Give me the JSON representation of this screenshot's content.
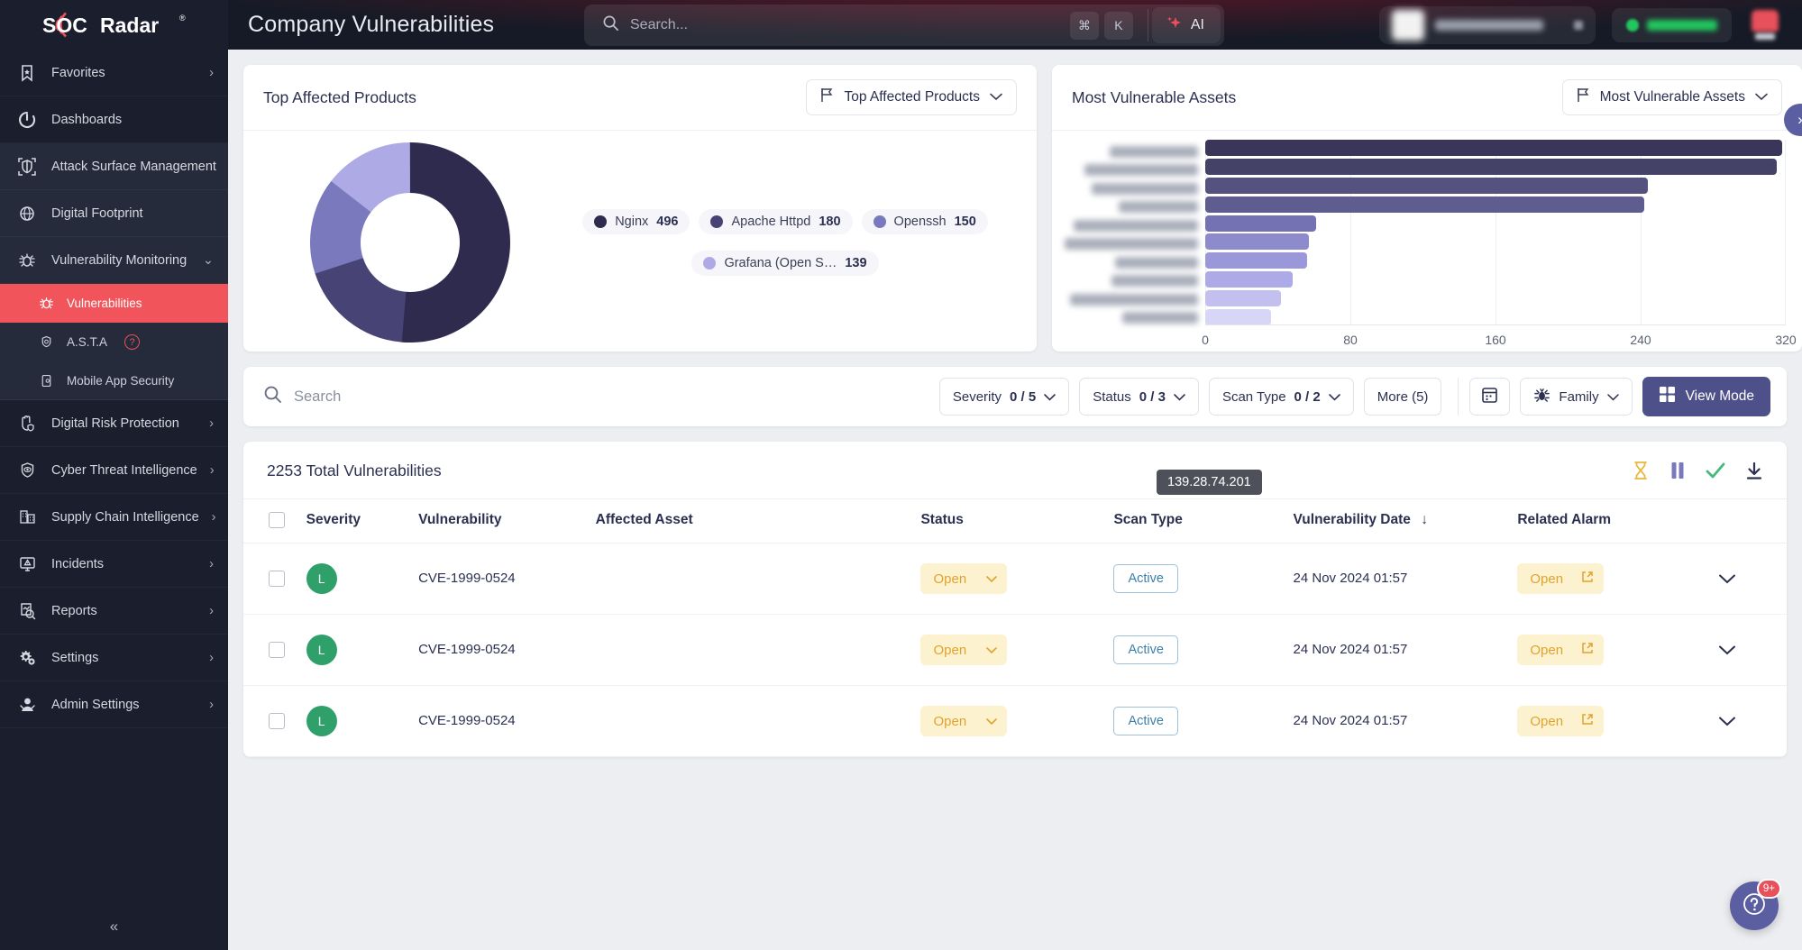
{
  "brand": {
    "name": "SOCRadar",
    "registered": "®"
  },
  "header": {
    "title": "Company Vulnerabilities",
    "search_placeholder": "Search...",
    "kbd_cmd": "⌘",
    "kbd_k": "K",
    "ai_label": "AI"
  },
  "sidebar": {
    "items": [
      {
        "label": "Favorites",
        "icon": "bookmark-star-icon",
        "chevron": "›"
      },
      {
        "label": "Dashboards",
        "icon": "dashboard-icon",
        "chevron": ""
      },
      {
        "label": "Attack Surface Management",
        "icon": "shield-scan-icon",
        "chevron": "⌄"
      },
      {
        "label": "Digital Footprint",
        "icon": "globe-icon",
        "chevron": ""
      },
      {
        "label": "Vulnerability Monitoring",
        "icon": "bug-icon",
        "chevron": "⌄"
      },
      {
        "label": "Digital Risk Protection",
        "icon": "hand-shield-icon",
        "chevron": "›"
      },
      {
        "label": "Cyber Threat Intelligence",
        "icon": "shield-eye-icon",
        "chevron": "›"
      },
      {
        "label": "Supply Chain Intelligence",
        "icon": "factory-icon",
        "chevron": "›"
      },
      {
        "label": "Incidents",
        "icon": "monitor-alert-icon",
        "chevron": "›"
      },
      {
        "label": "Reports",
        "icon": "report-search-icon",
        "chevron": "›"
      },
      {
        "label": "Settings",
        "icon": "gears-icon",
        "chevron": "›"
      },
      {
        "label": "Admin Settings",
        "icon": "admin-icon",
        "chevron": "›"
      }
    ],
    "sub_items": [
      {
        "label": "Vulnerabilities",
        "icon": "bug-icon",
        "active": true,
        "badge": ""
      },
      {
        "label": "A.S.T.A",
        "icon": "shield-badge-icon",
        "active": false,
        "badge": "?"
      },
      {
        "label": "Mobile App Security",
        "icon": "mobile-icon",
        "active": false,
        "badge": ""
      }
    ],
    "collapse": "«"
  },
  "cards": {
    "top_affected": {
      "title": "Top Affected Products",
      "selector": "Top Affected Products"
    },
    "most_vulnerable": {
      "title": "Most Vulnerable Assets",
      "selector": "Most Vulnerable Assets"
    }
  },
  "tooltip": "139.28.74.201",
  "filters": {
    "search_placeholder": "Search",
    "severity": {
      "label": "Severity",
      "value": "0 / 5"
    },
    "status": {
      "label": "Status",
      "value": "0 / 3"
    },
    "scan_type": {
      "label": "Scan Type",
      "value": "0 / 2"
    },
    "more": "More (5)",
    "calendar_icon": "calendar-icon",
    "family": "Family",
    "view_mode": "View Mode"
  },
  "table": {
    "total_text": "2253 Total Vulnerabilities",
    "tool_icons": [
      "hourglass-icon",
      "pause-icon",
      "check-icon",
      "download-icon"
    ],
    "columns": [
      "Severity",
      "Vulnerability",
      "Affected Asset",
      "Status",
      "Scan Type",
      "Vulnerability Date",
      "Related Alarm"
    ],
    "sort_arrow": "↓",
    "rows": [
      {
        "severity": "L",
        "vulnerability": "CVE-1999-0524",
        "asset": "",
        "status": "Open",
        "scan_type": "Active",
        "date": "24 Nov 2024 01:57",
        "alarm": "Open"
      },
      {
        "severity": "L",
        "vulnerability": "CVE-1999-0524",
        "asset": "",
        "status": "Open",
        "scan_type": "Active",
        "date": "24 Nov 2024 01:57",
        "alarm": "Open"
      },
      {
        "severity": "L",
        "vulnerability": "CVE-1999-0524",
        "asset": "",
        "status": "Open",
        "scan_type": "Active",
        "date": "24 Nov 2024 01:57",
        "alarm": "Open"
      }
    ]
  },
  "help": {
    "icon": "question-chat-icon",
    "badge": "9+"
  },
  "colors": {
    "accent_red": "#f2545b",
    "sidebar_bg": "#1b1f2d",
    "purple": "#4e5189",
    "status_yellow": "#e0a32e",
    "severity_green": "#2fa06a"
  },
  "chart_data": [
    {
      "type": "pie",
      "title": "Top Affected Products",
      "subtitle": "",
      "labels": [
        "Nginx",
        "Apache Httpd",
        "Openssh",
        "Grafana (Open S…"
      ],
      "values": [
        496,
        180,
        150,
        139
      ],
      "colors": [
        "#2e2b4f",
        "#474475",
        "#7b79bd",
        "#aeaae6"
      ],
      "legend_position": "right",
      "grid": false
    },
    {
      "type": "bar",
      "orientation": "horizontal",
      "title": "Most Vulnerable Assets",
      "categories": [
        "asset-1",
        "asset-2",
        "asset-3",
        "asset-4",
        "asset-5",
        "asset-6",
        "asset-7",
        "asset-8",
        "asset-9",
        "asset-10"
      ],
      "category_labels_redacted": true,
      "values": [
        318,
        315,
        244,
        242,
        61,
        57,
        56,
        48,
        42,
        36
      ],
      "colors": [
        "#393659",
        "#454268",
        "#55527f",
        "#5f5c90",
        "#7572b3",
        "#8e8bcd",
        "#9b98da",
        "#adaae8",
        "#c3c0f0",
        "#d8d6f6"
      ],
      "xlabel": "",
      "ylabel": "",
      "xlim": [
        0,
        320
      ],
      "xticks": [
        0,
        80,
        160,
        240,
        320
      ],
      "grid": true
    }
  ]
}
